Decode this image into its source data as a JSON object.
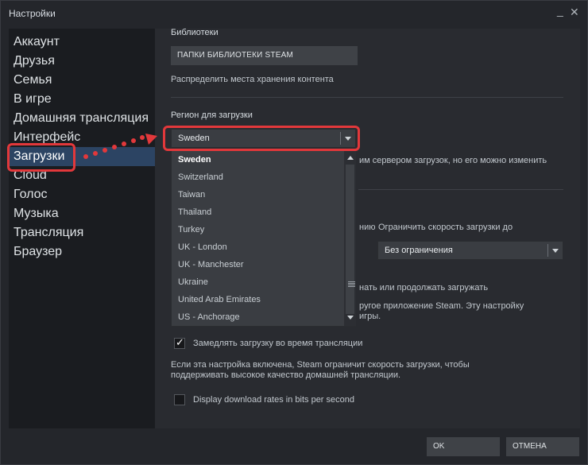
{
  "window": {
    "title": "Настройки",
    "minimize_glyph": "_",
    "close_glyph": "✕"
  },
  "sidebar": {
    "items": [
      {
        "label": "Аккаунт"
      },
      {
        "label": "Друзья"
      },
      {
        "label": "Семья"
      },
      {
        "label": "В игре"
      },
      {
        "label": "Домашняя трансляция"
      },
      {
        "label": "Интерфейс"
      },
      {
        "label": "Загрузки",
        "active": true
      },
      {
        "label": "Cloud"
      },
      {
        "label": "Голос"
      },
      {
        "label": "Музыка"
      },
      {
        "label": "Трансляция"
      },
      {
        "label": "Браузер"
      }
    ]
  },
  "libraries": {
    "heading": "Библиотеки",
    "button_label": "ПАПКИ БИБЛИОТЕКИ STEAM",
    "caption": "Распределить места хранения контента"
  },
  "region": {
    "heading": "Регион для загрузки",
    "selected": "Sweden",
    "note_fragment": "им сервером загрузок, но его можно изменить",
    "options": [
      "Sweden",
      "Switzerland",
      "Taiwan",
      "Thailand",
      "Turkey",
      "UK - London",
      "UK - Manchester",
      "Ukraine",
      "United Arab Emirates",
      "US - Anchorage"
    ]
  },
  "limit": {
    "partial_left": "нию",
    "label": "Ограничить скорость загрузки до",
    "value": "Без ограничения"
  },
  "background": {
    "line1": "нать или продолжать загружать",
    "line2": "ругое приложение Steam. Эту настройку",
    "line3": "игры."
  },
  "throttle": {
    "checked": true,
    "label": "Замедлять загрузку во время трансляции",
    "desc1": "Если эта настройка включена, Steam ограничит скорость загрузки, чтобы",
    "desc2": "поддерживать высокое качество домашней трансляции."
  },
  "bits": {
    "checked": false,
    "label": "Display download rates in bits per second"
  },
  "footer": {
    "ok_label": "OK",
    "cancel_label": "ОТМЕНА"
  },
  "colors": {
    "highlight": "#e2383b",
    "active_nav": "#2c4463",
    "background": "#24262b"
  },
  "icons": {
    "dropdown_arrow": "chevron-down-icon",
    "scroll_up": "arrow-up-icon",
    "scroll_down": "arrow-down-icon",
    "check": "checkmark-icon"
  }
}
